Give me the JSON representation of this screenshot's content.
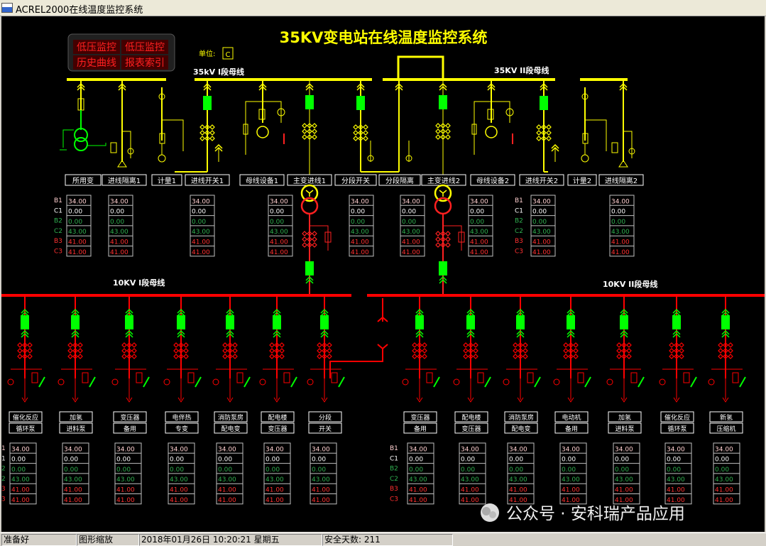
{
  "window": {
    "title": "ACREL2000在线温度监控系统"
  },
  "header": {
    "title": "35KV变电站在线温度监控系统",
    "unit_label": "单位:",
    "unit_value": "C",
    "menu": [
      "低压监控",
      "低压监控",
      "历史曲线",
      "报表索引"
    ]
  },
  "buses": {
    "b35_1": "35kV I段母线",
    "b35_2": "35KV II段母线",
    "b10_1": "10KV I段母线",
    "b10_2": "10KV II段母线"
  },
  "bay_labels_35": [
    "所用变",
    "进线隔离1",
    "计量1",
    "进线开关1",
    "母线设备1",
    "主变进线1",
    "分段开关",
    "分段隔离",
    "主变进线2",
    "母线设备2",
    "进线开关2",
    "计量2",
    "进线隔离2"
  ],
  "feeder_labels_left": [
    [
      "催化反应",
      "循环泵"
    ],
    [
      "加氢",
      "进料泵"
    ],
    [
      "变压器",
      "备用"
    ],
    [
      "电伴热",
      "专变"
    ],
    [
      "消防泵房",
      "配电变"
    ],
    [
      "配电楼",
      "变压器"
    ],
    [
      "分段",
      "开关"
    ]
  ],
  "feeder_labels_right": [
    [
      "变压器",
      "备用"
    ],
    [
      "配电楼",
      "变压器"
    ],
    [
      "消防泵房",
      "配电变"
    ],
    [
      "电动机",
      "备用"
    ],
    [
      "加氢",
      "进料泵"
    ],
    [
      "催化反应",
      "循环泵"
    ],
    [
      "新氢",
      "压缩机"
    ]
  ],
  "phase_labels": [
    "B1",
    "C1",
    "B2",
    "C2",
    "B3",
    "C3"
  ],
  "phase_labels_partial": [
    "1",
    "1",
    "2",
    "2",
    "3",
    "3"
  ],
  "readings": [
    "34.00",
    "0.00",
    "0.00",
    "43.00",
    "41.00",
    "41.00"
  ],
  "statusbar": {
    "ready": "准备好",
    "zoom": "图形缩放",
    "datetime": "2018年01月26日  10:20:21  星期五",
    "safe_days": "安全天数: 211"
  },
  "watermark": "公众号 · 安科瑞产品应用",
  "colors": {
    "bus_yellow": "#ffff00",
    "bus_red": "#ff0000",
    "breaker_green": "#00ff00",
    "bg": "#000000",
    "temp_high": "#ff2020",
    "temp_low": "#20a040"
  }
}
